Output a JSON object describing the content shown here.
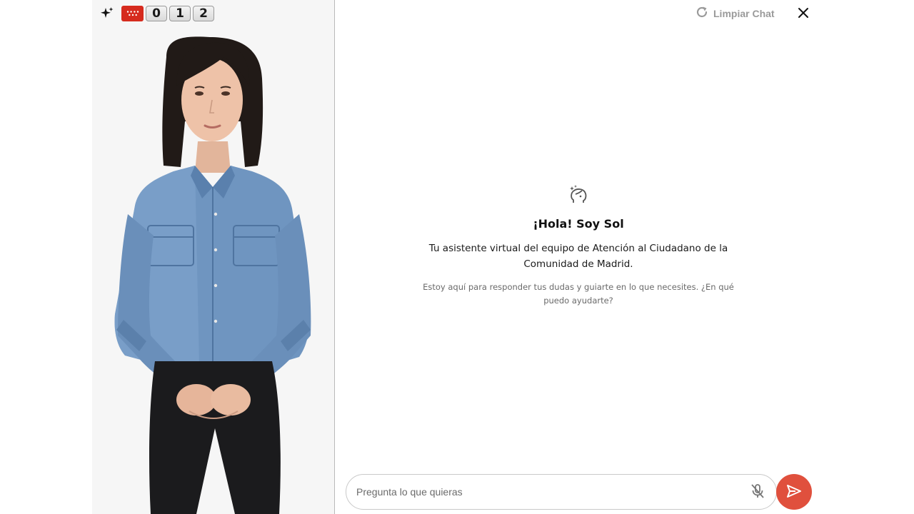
{
  "brand": {
    "logo_digits": [
      "0",
      "1",
      "2"
    ],
    "flag_color": "#d62b1e",
    "sparkle_icon": "sparkle-icon",
    "flag_icon": "madrid-flag-icon"
  },
  "header": {
    "clear_chat_label": "Limpiar Chat",
    "clear_chat_icon": "refresh-icon",
    "close_icon": "close-icon"
  },
  "welcome": {
    "icon": "assistant-face-icon",
    "title": "¡Hola! Soy Sol",
    "subtitle": "Tu asistente virtual del equipo de Atención al Ciudadano de la Comunidad de Madrid.",
    "hint": "Estoy aquí para responder tus dudas y guiarte en lo que necesites. ¿En qué puedo ayudarte?"
  },
  "composer": {
    "placeholder": "Pregunta lo que quieras",
    "value": "",
    "mic_icon": "mic-off-icon",
    "send_icon": "send-icon",
    "send_color": "#e0503d"
  },
  "avatar": {
    "icon": "avatar-person-illustration"
  }
}
